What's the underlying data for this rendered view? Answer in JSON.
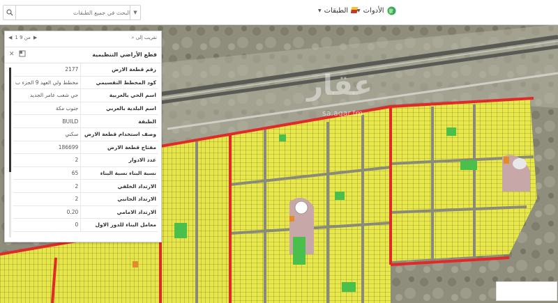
{
  "toolbar": {
    "search_placeholder": "البحث في جميع الطبقات",
    "tools_label": "الأدوات",
    "layers_label": "الطبقات"
  },
  "panel": {
    "zoom_to_label": "تقريب إلى",
    "pager_text": "1 من 9",
    "title": "قطع الأراضي التنظيمية",
    "rows": [
      {
        "label": "رقم قطعة الارض",
        "value": "2177"
      },
      {
        "label": "كود المخطط التقسيمي",
        "value": "مخطط ولي العهد 9 الجزء ب"
      },
      {
        "label": "اسم الحي بالعربية",
        "value": "حي شعب عامر الجديد"
      },
      {
        "label": "اسم البلدية بالعربي",
        "value": "جنوب مكة"
      },
      {
        "label": "الطبقة",
        "value": "BUILD"
      },
      {
        "label": "وصف استخدام قطعة الارض",
        "value": "سكني"
      },
      {
        "label": "مفتاح قطعة الارض",
        "value": "186699"
      },
      {
        "label": "عدد الادوار",
        "value": "2"
      },
      {
        "label": "نسبة البناء نسبة البناء",
        "value": "65"
      },
      {
        "label": "الارتداد الخلفي",
        "value": "2"
      },
      {
        "label": "الارتداد الجانبي",
        "value": "2"
      },
      {
        "label": "الارتداد الامامي",
        "value": "0.20"
      },
      {
        "label": "معامل البناء للدور الاول",
        "value": "0"
      }
    ]
  },
  "watermark": {
    "brand": "عقار",
    "site": "sa.aqar.fm"
  },
  "colors": {
    "plot": "#e8e84a",
    "boundary": "#e02a2a",
    "park": "#4bbf4b",
    "terrain": "#8f8d7b"
  },
  "icons": {
    "search": "search-icon",
    "tools": "globe-icon",
    "layers": "layers-icon",
    "close": "close-icon",
    "dock": "dock-icon"
  }
}
